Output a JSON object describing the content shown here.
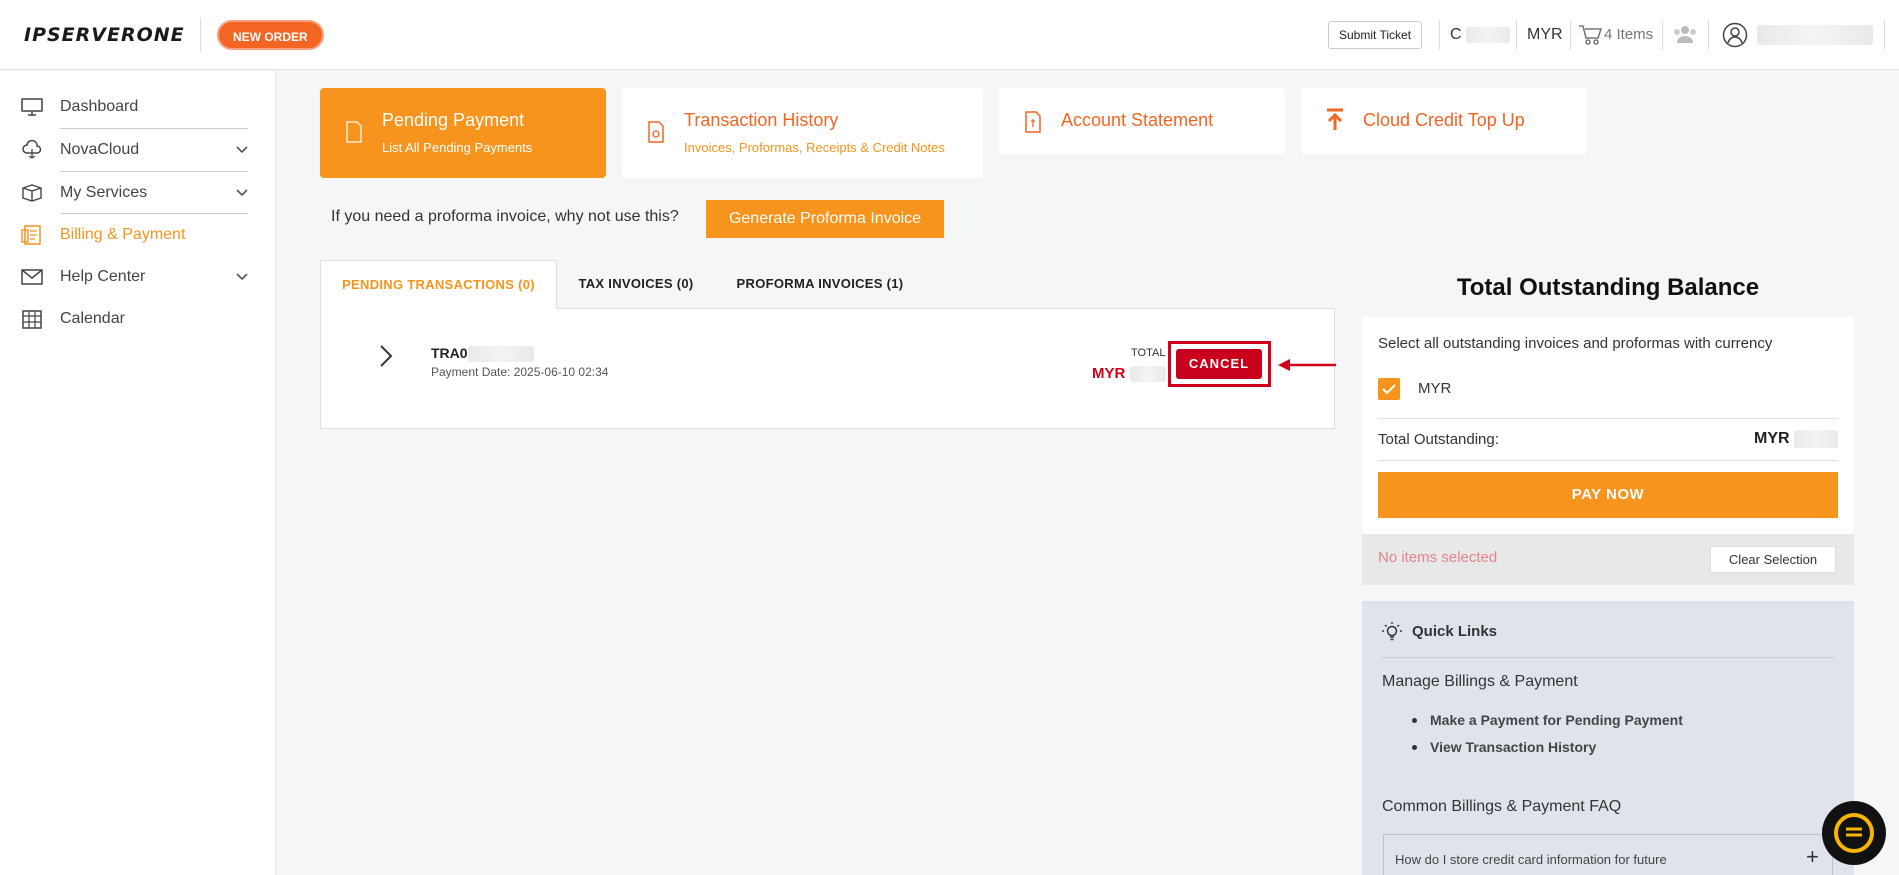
{
  "header": {
    "logo_text": "IPSERVERONE",
    "new_order_label": "NEW ORDER",
    "submit_ticket_label": "Submit Ticket",
    "credit_prefix": "C",
    "currency": "MYR",
    "cart_label": "4 Items"
  },
  "sidebar": {
    "items": [
      {
        "label": "Dashboard",
        "icon": "monitor-icon"
      },
      {
        "label": "NovaCloud",
        "icon": "cloud-icon"
      },
      {
        "label": "My Services",
        "icon": "box-icon"
      },
      {
        "label": "Billing & Payment",
        "icon": "billing-icon"
      },
      {
        "label": "Help Center",
        "icon": "mail-icon"
      },
      {
        "label": "Calendar",
        "icon": "calendar-icon"
      }
    ]
  },
  "cards": [
    {
      "title": "Pending Payment",
      "subtitle": "List All Pending Payments"
    },
    {
      "title": "Transaction History",
      "subtitle": "Invoices, Proformas, Receipts & Credit Notes"
    },
    {
      "title": "Account Statement",
      "subtitle": ""
    },
    {
      "title": "Cloud Credit Top Up",
      "subtitle": ""
    }
  ],
  "proforma": {
    "prompt": "If you need a proforma invoice, why not use this?",
    "button_label": "Generate Proforma Invoice"
  },
  "tabs": [
    {
      "label": "PENDING TRANSACTIONS (0)"
    },
    {
      "label": "TAX INVOICES (0)"
    },
    {
      "label": "PROFORMA INVOICES (1)"
    }
  ],
  "transaction": {
    "id_prefix": "TRA0",
    "payment_date": "Payment Date: 2025-06-10 02:34",
    "total_label": "TOTAL",
    "total_currency": "MYR",
    "cancel_label": "CANCEL"
  },
  "outstanding": {
    "title": "Total Outstanding Balance",
    "description": "Select all outstanding invoices and proformas with currency",
    "currency_option": "MYR",
    "total_label": "Total Outstanding:",
    "total_currency": "MYR",
    "pay_now_label": "PAY NOW",
    "selection_status": "No items selected",
    "clear_label": "Clear Selection"
  },
  "quick_links": {
    "title": "Quick Links",
    "section1_heading": "Manage Billings & Payment",
    "links": [
      "Make a Payment for Pending Payment",
      "View Transaction History"
    ],
    "section2_heading": "Common Billings & Payment FAQ",
    "faq_question": "How do I store credit card information for future"
  },
  "colors": {
    "accent": "#f7941d",
    "brand_orange": "#f26522",
    "danger": "#c8001e"
  }
}
